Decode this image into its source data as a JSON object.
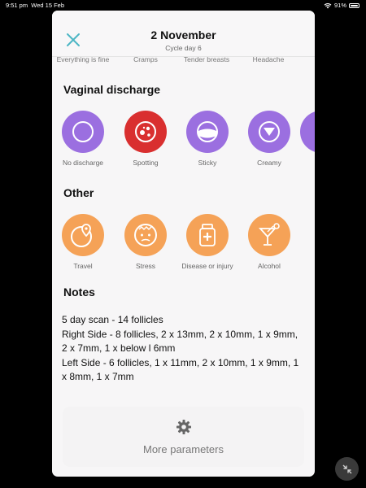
{
  "status_bar": {
    "time": "9:51 pm",
    "date": "Wed 15 Feb",
    "battery": "91%"
  },
  "header": {
    "title": "2 November",
    "subtitle": "Cycle day 6"
  },
  "symptoms": [
    "Everything is fine",
    "Cramps",
    "Tender breasts",
    "Headache"
  ],
  "discharge": {
    "title": "Vaginal discharge",
    "options": [
      "No discharge",
      "Spotting",
      "Sticky",
      "Creamy"
    ]
  },
  "other": {
    "title": "Other",
    "options": [
      "Travel",
      "Stress",
      "Disease or injury",
      "Alcohol"
    ]
  },
  "notes": {
    "title": "Notes",
    "lines": [
      "5 day scan - 14 follicles",
      "Right Side - 8 follicles, 2 x 13mm, 2 x 10mm, 1 x 9mm, 2 x 7mm, 1 x below l 6mm",
      "Left Side - 6 follicles, 1 x 11mm, 2 x 10mm, 1 x 9mm, 1 x 8mm, 1 x 7mm"
    ]
  },
  "more": {
    "label": "More parameters"
  },
  "colors": {
    "accent": "#4db6c4",
    "purple": "#9b6fe0",
    "red": "#d92f2f",
    "orange": "#f5a257"
  },
  "icons": [
    "close-icon",
    "wifi-icon",
    "battery-icon",
    "gear-icon",
    "collapse-icon"
  ]
}
